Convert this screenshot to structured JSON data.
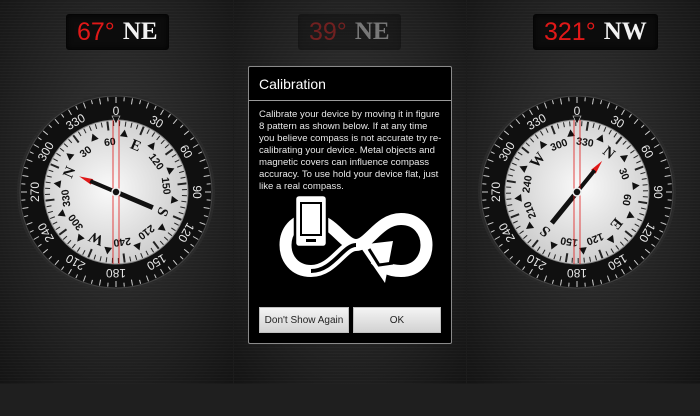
{
  "screens": [
    {
      "id": "left",
      "heading": {
        "degrees": "67°",
        "direction": "NE"
      },
      "heading_deg": 67
    },
    {
      "id": "center",
      "heading": {
        "degrees": "39°",
        "direction": "NE"
      },
      "heading_deg": 39
    },
    {
      "id": "right",
      "heading": {
        "degrees": "321°",
        "direction": "NW"
      },
      "heading_deg": 321
    }
  ],
  "bezel_labels": [
    "0",
    "30",
    "60",
    "90",
    "120",
    "150",
    "180",
    "210",
    "240",
    "270",
    "300",
    "330"
  ],
  "dial_labels": [
    "N",
    "30",
    "60",
    "E",
    "120",
    "150",
    "S",
    "210",
    "240",
    "W",
    "300",
    "330"
  ],
  "dialog": {
    "title": "Calibration",
    "body": "Calibrate your device by moving it in figure 8 pattern as shown below. If at any time you believe compass is not accurate try re-calibrating your device. Metal objects and magnetic covers can influence compass accuracy. To use hold your device flat, just like a real compass.",
    "buttons": {
      "dont_show": "Don't Show Again",
      "ok": "OK"
    }
  },
  "colors": {
    "accent_red": "#e01818",
    "heading_text": "#f2f2f2",
    "dial_face": "#ececec",
    "bezel": "#101010"
  },
  "icons": [
    "phone-icon",
    "figure-eight-arrow-icon"
  ]
}
